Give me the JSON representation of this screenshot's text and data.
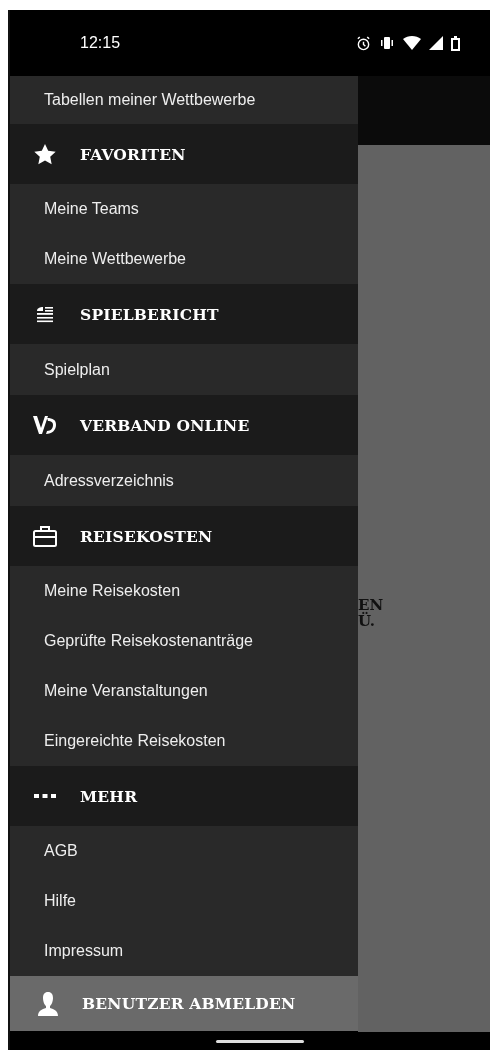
{
  "status_bar": {
    "time": "12:15"
  },
  "drawer": {
    "top_items": [
      "Tabellen meiner Wettbewerbe"
    ],
    "sections": [
      {
        "title": "FAVORITEN",
        "items": [
          "Meine Teams",
          "Meine Wettbewerbe"
        ]
      },
      {
        "title": "SPIELBERICHT",
        "items": [
          "Spielplan"
        ]
      },
      {
        "title": "VERBAND ONLINE",
        "items": [
          "Adressverzeichnis"
        ]
      },
      {
        "title": "REISEKOSTEN",
        "items": [
          "Meine Reisekosten",
          "Geprüfte Reisekostenanträge",
          "Meine Veranstaltungen",
          "Eingereichte Reisekosten"
        ]
      },
      {
        "title": "MEHR",
        "items": [
          "AGB",
          "Hilfe",
          "Impressum"
        ]
      }
    ],
    "logout": "BENUTZER ABMELDEN"
  },
  "background_text": [
    "EN",
    "Ü."
  ]
}
